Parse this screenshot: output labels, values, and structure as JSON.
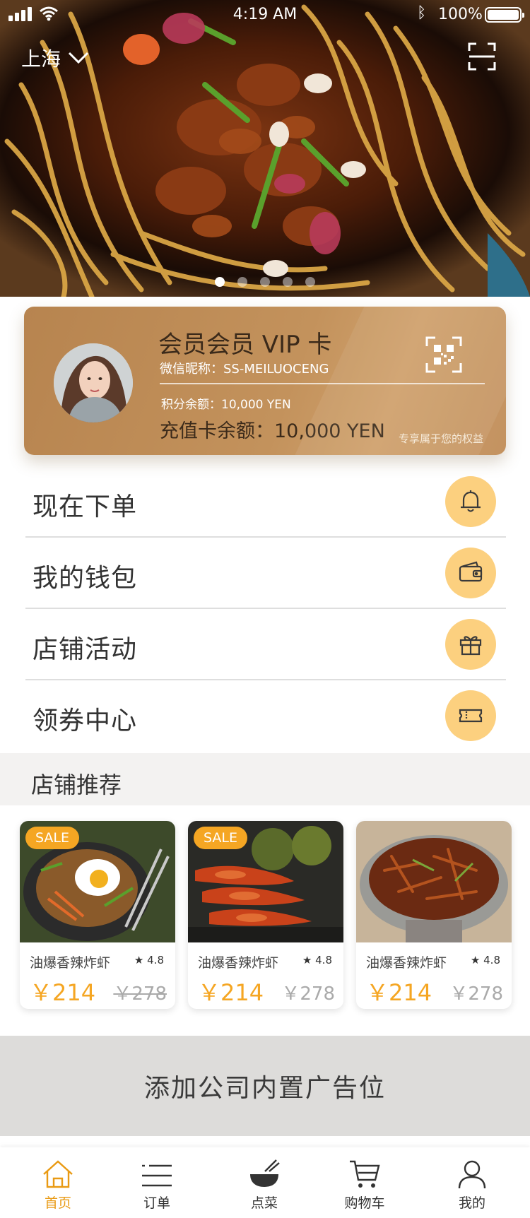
{
  "status_bar": {
    "time": "4:19 AM",
    "battery": "100%"
  },
  "header": {
    "city": "上海"
  },
  "banner": {
    "dot_count": 5,
    "active_dot": 0
  },
  "vip_card": {
    "title": "会员会员 VIP 卡",
    "nickname": "微信昵称：SS-MEILUOCENG",
    "points": "积分余额：10,000 YEN",
    "balance": "充值卡余额：10,000 YEN",
    "rights": "专享属于您的权益"
  },
  "menu": {
    "items": [
      {
        "label": "现在下单",
        "icon": "bell-icon"
      },
      {
        "label": "我的钱包",
        "icon": "wallet-icon"
      },
      {
        "label": "店铺活动",
        "icon": "gift-icon"
      },
      {
        "label": "领券中心",
        "icon": "ticket-icon"
      }
    ]
  },
  "recommend": {
    "title": "店铺推荐",
    "products": [
      {
        "name": "油爆香辣炸虾",
        "rating": "4.8",
        "price": "￥214",
        "old_price": "￥278",
        "badge": "SALE",
        "old_price_struck": true
      },
      {
        "name": "油爆香辣炸虾",
        "rating": "4.8",
        "price": "￥214",
        "old_price": "￥278",
        "badge": "SALE",
        "old_price_struck": false
      },
      {
        "name": "油爆香辣炸虾",
        "rating": "4.8",
        "price": "￥214",
        "old_price": "￥278",
        "badge": "",
        "old_price_struck": false
      }
    ]
  },
  "ad": {
    "text": "添加公司内置广告位"
  },
  "tabbar": {
    "items": [
      {
        "label": "首页",
        "icon": "home-icon",
        "active": true
      },
      {
        "label": "订单",
        "icon": "list-icon",
        "active": false
      },
      {
        "label": "点菜",
        "icon": "bowl-icon",
        "active": false
      },
      {
        "label": "购物车",
        "icon": "cart-icon",
        "active": false
      },
      {
        "label": "我的",
        "icon": "user-icon",
        "active": false
      }
    ]
  },
  "colors": {
    "accent": "#f5a623",
    "icon_bg": "#fcd07f",
    "card_gold": "#c3925c",
    "tab_active": "#e99a13"
  }
}
